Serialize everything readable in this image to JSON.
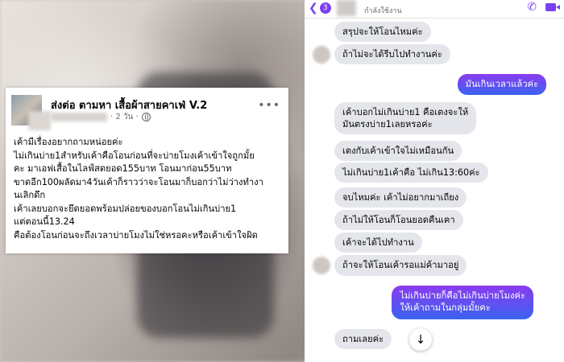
{
  "post": {
    "group_name": "ส่งต่อ ตามหา เสื้อผ้าสายคาเฟ่ V.2",
    "time": "2 วัน",
    "body_lines": [
      "เค้ามีเรื่องอยากถามหน่อยค่ะ",
      "ไม่เกินบ่าย1สำหรับเค้าคือโอนก่อนที่จะบ่ายโมงเค้าเข้าใจถูกมั้ย",
      "คะ มาเอฟเสื้อในไลฟ์สดยอด155บาท โอนมาก่อน55บาท",
      "ขาดอีก100ผลัดมา4วันเค้าก็ราวว่าจะโอนมาก็บอกว่าไม่ว่างทำงา",
      "นเลิกดึก",
      "เค้าเลยบอกจะยึดยอดพร้อมปล่อยของบอกโอนไม่เกินบ่าย1",
      "แต่ตอนนี้13.24",
      "คือต้องโอนก่อนจะถึงเวลาบ่ายโมงไม่ใช่หรอคะหรือเค้าเข้าใจผิด"
    ]
  },
  "chat": {
    "header": {
      "back_count": "3",
      "status": "กำลังใช้งาน"
    },
    "messages": [
      {
        "side": "in",
        "text": "สรุปจะให้โอนไหมค่ะ"
      },
      {
        "side": "in",
        "text": "ถ้าไม่จะได้รีบไปทำงานค่ะ"
      },
      {
        "side": "out",
        "text": "มันเกินเวลาแล้วค่ะ"
      },
      {
        "side": "in",
        "text": "เค้าบอกไม่เกินบ่าย1 คือเตงจะให้\nมันตรงบ่าย1เลยหรอค่ะ"
      },
      {
        "side": "in",
        "text": "เตงกับเค้าเข้าใจไม่เหมือนกัน"
      },
      {
        "side": "in",
        "text": "ไม่เกินบ่าย1เค้าคือ ไม่เกิน13:60ค่ะ"
      },
      {
        "side": "in",
        "text": "จบไหมค่ะ เค้าไม่อยากมาเถียง"
      },
      {
        "side": "in",
        "text": "ถ้าไม่ให้โอนก็โอนยอดคืนเคา"
      },
      {
        "side": "in",
        "text": "เค้าจะได้ไปทำงาน"
      },
      {
        "side": "in",
        "text": "ถ้าจะให้โอนเค้ารอแม่ค้ามาอยู่"
      },
      {
        "side": "out",
        "text": "ไม่เกินบ่ายก็คือไม่เกินบ่ายโมงค่ะ\nให้เค้าถามในกลุ่มมั้ยคะ"
      },
      {
        "side": "in",
        "text": "ถามเลยค่ะ"
      }
    ]
  },
  "colors": {
    "messenger_purple": "#7b3ff2",
    "outgoing_gradient_top": "#8b3bf0",
    "outgoing_gradient_bottom": "#3a63f0",
    "incoming_bubble": "#e4e6eb"
  },
  "icons": [
    "back-arrow-icon",
    "phone-icon",
    "video-call-icon",
    "globe-icon",
    "more-icon",
    "arrow-down-icon"
  ]
}
